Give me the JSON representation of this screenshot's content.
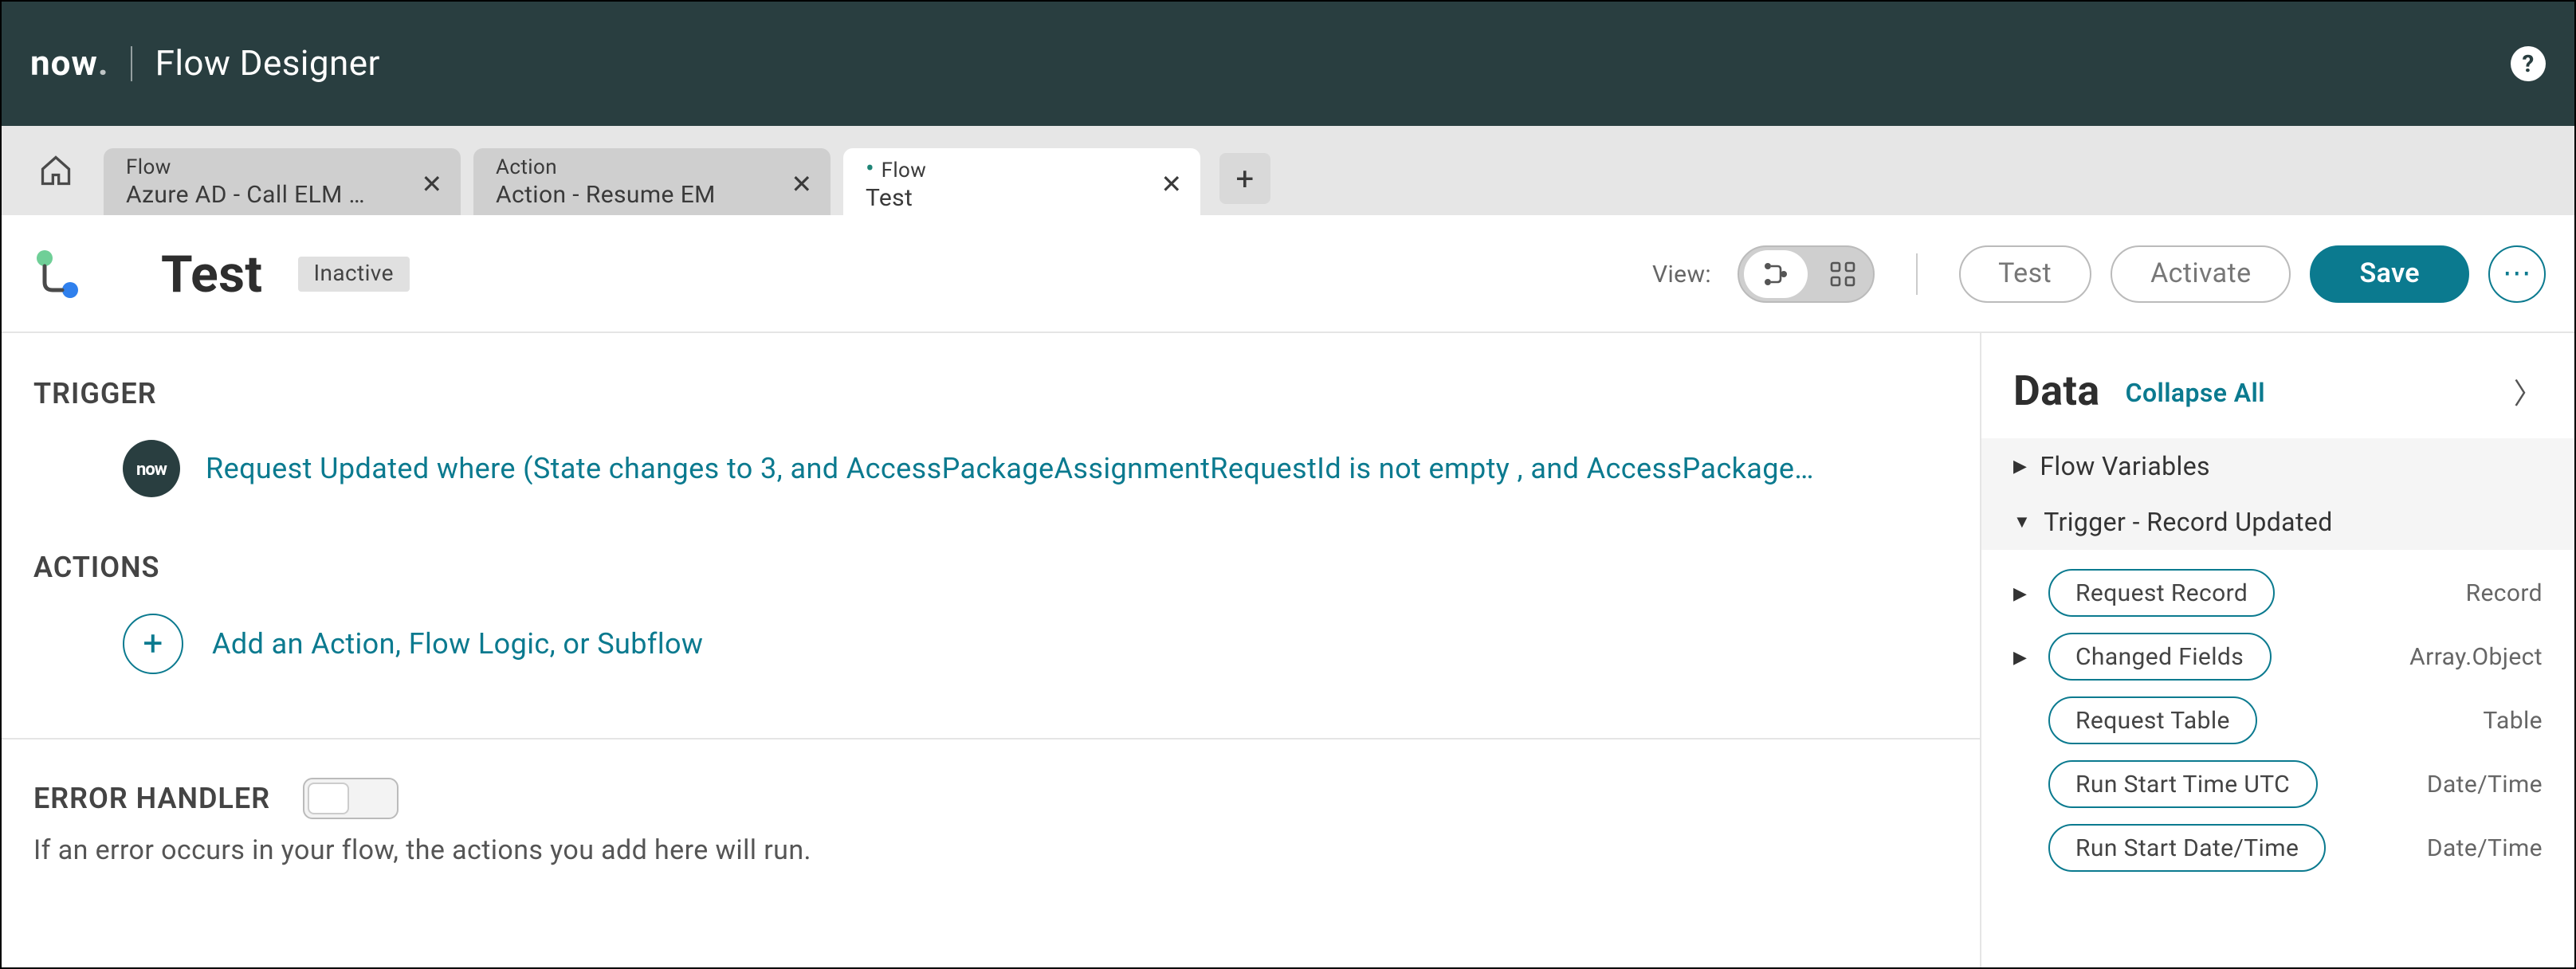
{
  "header": {
    "logo_text": "now",
    "product_title": "Flow Designer"
  },
  "tabs": [
    {
      "type": "Flow",
      "title": "Azure AD - Call ELM …",
      "active": false
    },
    {
      "type": "Action",
      "title": "Action - Resume EM",
      "active": false
    },
    {
      "type": "Flow",
      "title": "Test",
      "active": true
    }
  ],
  "toolbar": {
    "page_title": "Test",
    "status": "Inactive",
    "view_label": "View:",
    "buttons": {
      "test": "Test",
      "activate": "Activate",
      "save": "Save"
    }
  },
  "canvas": {
    "trigger_header": "TRIGGER",
    "trigger_icon_text": "now",
    "trigger_text": "Request Updated where (State changes to 3, and AccessPackageAssignmentRequestId is not empty , and AccessPackageAs…",
    "actions_header": "ACTIONS",
    "add_action_text": "Add an Action, Flow Logic, or Subflow",
    "error_header": "ERROR HANDLER",
    "error_desc": "If an error occurs in your flow, the actions you add here will run."
  },
  "data_panel": {
    "title": "Data",
    "collapse_label": "Collapse All",
    "sections": [
      {
        "label": "Flow Variables",
        "expanded": false
      },
      {
        "label": "Trigger - Record Updated",
        "expanded": true
      }
    ],
    "pills": [
      {
        "label": "Request Record",
        "type": "Record",
        "expandable": true
      },
      {
        "label": "Changed Fields",
        "type": "Array.Object",
        "expandable": true
      },
      {
        "label": "Request Table",
        "type": "Table",
        "expandable": false
      },
      {
        "label": "Run Start Time UTC",
        "type": "Date/Time",
        "expandable": false
      },
      {
        "label": "Run Start Date/Time",
        "type": "Date/Time",
        "expandable": false
      }
    ]
  }
}
